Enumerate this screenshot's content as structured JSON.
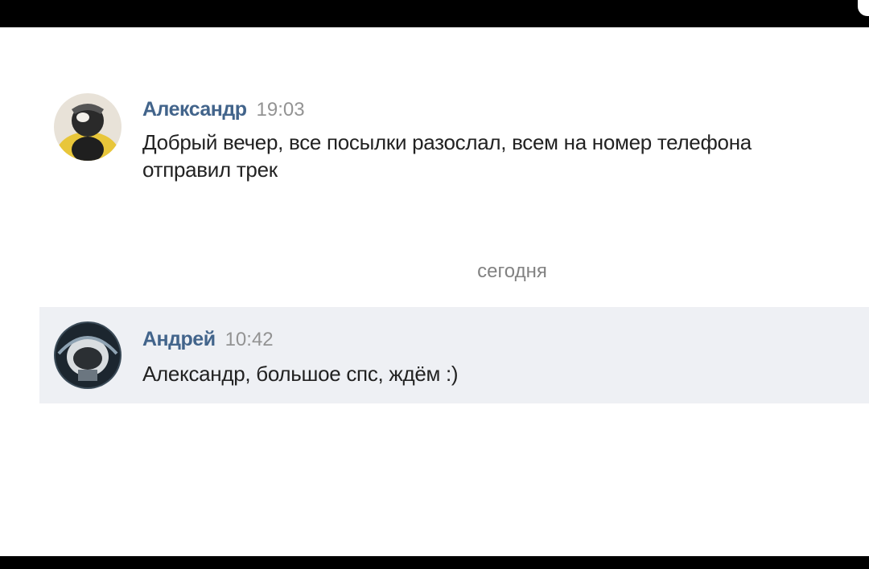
{
  "messages": [
    {
      "author": "Александр",
      "time": "19:03",
      "text": "Добрый вечер, все посылки разослал, всем на номер телефона отправил трек"
    },
    {
      "author": "Андрей",
      "time": "10:42",
      "text": "Александр, большое спс, ждём :)"
    }
  ],
  "date_separator": "сегодня",
  "colors": {
    "author": "#42648b",
    "time": "#939393",
    "text": "#222222",
    "highlight_bg": "#eef0f4",
    "separator": "#828282"
  },
  "icons": {
    "avatar_1": "user-avatar-photo",
    "avatar_2": "user-avatar-photo"
  }
}
